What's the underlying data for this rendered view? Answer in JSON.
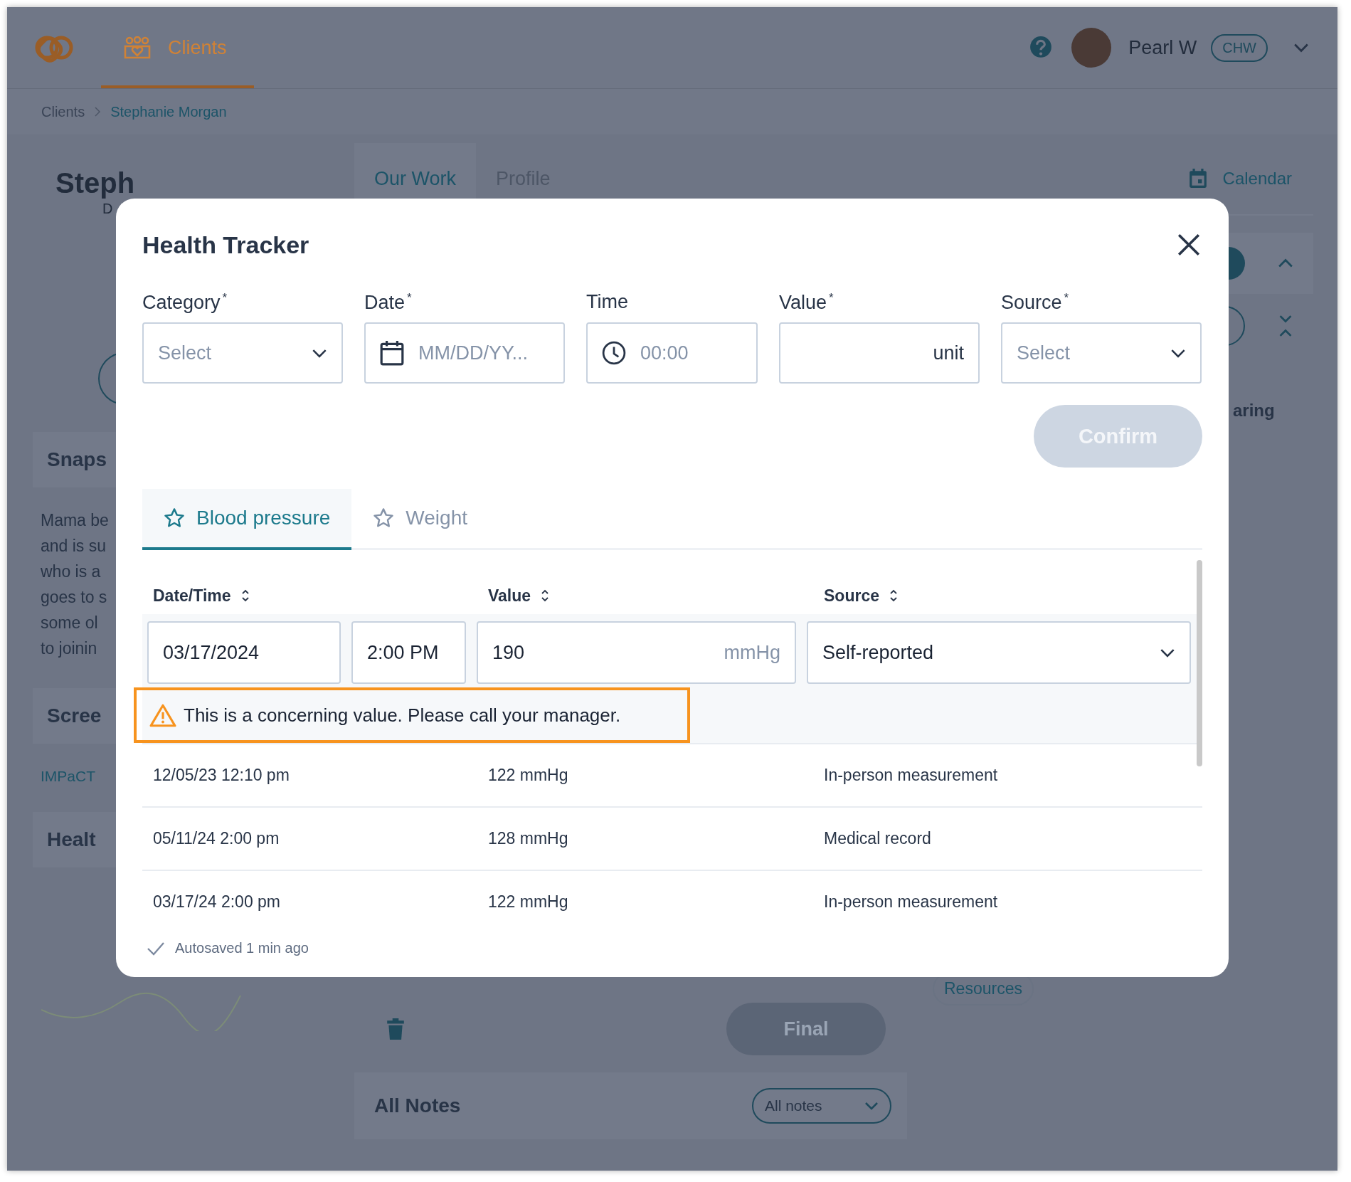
{
  "header": {
    "nav_tab": {
      "label": "Clients",
      "selected": true
    },
    "user": {
      "name": "Pearl W",
      "role": "CHW"
    }
  },
  "breadcrumb": [
    "Clients",
    "Stephanie Morgan"
  ],
  "background": {
    "client_name": "Steph",
    "client_subtitle": "D",
    "sections": [
      {
        "kind": "heading",
        "text": "Snaps"
      },
      {
        "kind": "paragraph",
        "lines": [
          "Mama be",
          "and is su",
          "who is a",
          "goes to s",
          "some ol",
          "to joinin"
        ]
      },
      {
        "kind": "heading",
        "text": "Scree"
      },
      {
        "kind": "link",
        "text": "IMPaCT"
      },
      {
        "kind": "heading",
        "text": "Healt"
      }
    ],
    "tabs": [
      {
        "label": "Our Work",
        "selected": true
      },
      {
        "label": "Profile",
        "selected": false
      }
    ],
    "calendar": "Calendar",
    "right_text": "aring",
    "resource_tag": "Resources",
    "final_button": {
      "label": "Final",
      "disabled": true
    },
    "notes": {
      "title": "All Notes",
      "filter": "All notes"
    }
  },
  "modal": {
    "title": "Health Tracker",
    "fields": [
      {
        "kind": "select",
        "label": "Category$^{*}$",
        "placeholder": "Select"
      },
      {
        "kind": "date",
        "label": "Date$^{*}$",
        "placeholder": "MM/DD/YY..."
      },
      {
        "kind": "time",
        "label": "Time",
        "placeholder": "00:00"
      },
      {
        "kind": "value",
        "label": "Value$^{*}$",
        "unit": "unit"
      },
      {
        "kind": "select",
        "label": "Source$^{*}$",
        "placeholder": "Select"
      }
    ],
    "confirm": {
      "label": "Confirm",
      "disabled": true
    },
    "tabs": [
      {
        "label": "Blood pressure",
        "selected": true
      },
      {
        "label": "Weight",
        "selected": false
      }
    ],
    "table": {
      "columns": [
        "Date/Time",
        "Value",
        "Source"
      ],
      "edit_row": {
        "date": "03/17/2024",
        "time": "2:00 PM",
        "value": "190",
        "unit": "mmHg",
        "source": "Self-reported"
      },
      "warning": "This is a concerning value. Please call your manager.",
      "rows": [
        {
          "datetime": "12/05/23 12:10 pm",
          "value": "122 mmHg",
          "source": "In-person measurement"
        },
        {
          "datetime": "05/11/24 2:00 pm",
          "value": "128 mmHg",
          "source": "Medical record"
        },
        {
          "datetime": "03/17/24 2:00 pm",
          "value": "122 mmHg",
          "source": "In-person measurement"
        }
      ]
    },
    "autosave": "Autosaved 1 min ago"
  }
}
